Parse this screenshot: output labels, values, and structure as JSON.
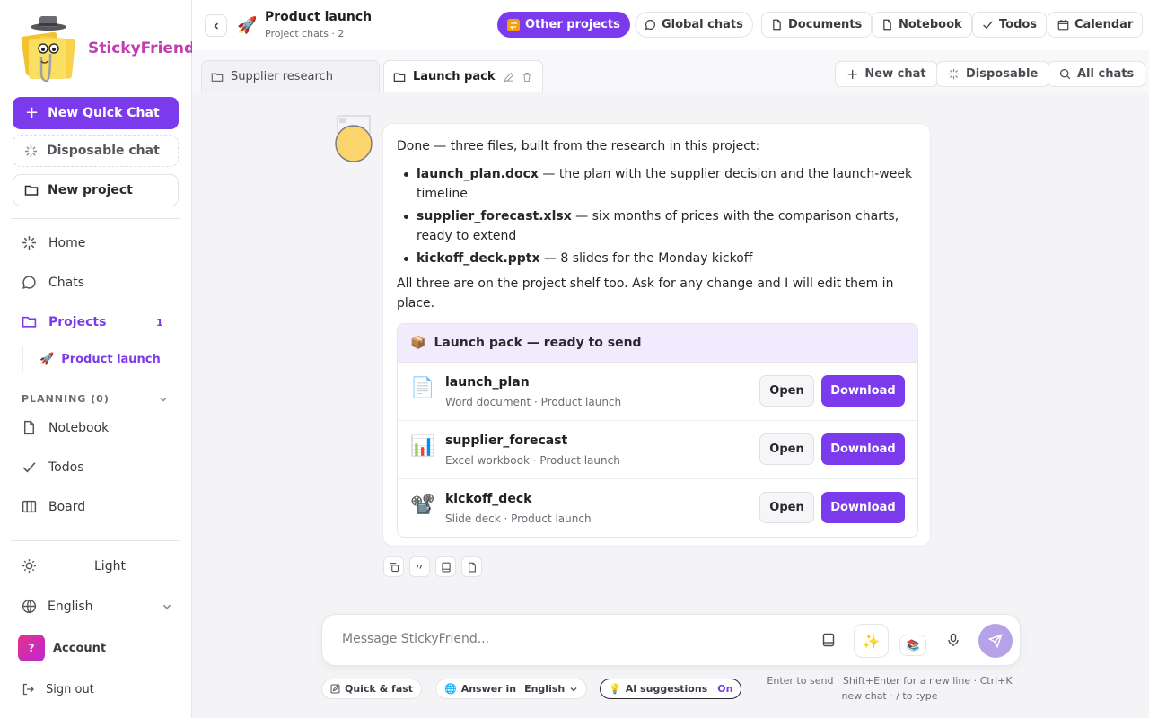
{
  "brand": {
    "name": "StickyFriend",
    "color": "#c03fb0"
  },
  "colors": {
    "accent": "#7c3aed",
    "send": "#b6a2e6"
  },
  "sidebar": {
    "new_quick_chat": "New Quick Chat",
    "disposable_chat": "Disposable chat",
    "new_project": "New project",
    "nav": [
      {
        "label": "Home",
        "icon": "sparkle-icon"
      },
      {
        "label": "Chats",
        "icon": "chat-bubble-icon"
      },
      {
        "label": "Projects",
        "icon": "folder-icon",
        "count": "1"
      }
    ],
    "project_child": {
      "emoji": "🚀",
      "label": "Product launch"
    },
    "planning": {
      "title": "PLANNING (0)",
      "items": [
        {
          "label": "Notebook",
          "icon": "document-icon"
        },
        {
          "label": "Todos",
          "icon": "check-icon"
        },
        {
          "label": "Board",
          "icon": "board-icon"
        }
      ]
    },
    "theme_label": "Light",
    "language_label": "English",
    "account": {
      "initial": "?",
      "label": "Account"
    },
    "sign_out": "Sign out"
  },
  "topbar": {
    "project_emoji": "🚀",
    "project_title": "Product launch",
    "project_subtitle": "Project chats · 2",
    "other_projects": "Other projects",
    "global_chats": "Global chats",
    "documents": "Documents",
    "notebook": "Notebook",
    "todos": "Todos",
    "calendar": "Calendar"
  },
  "tabs": [
    {
      "label": "Supplier research",
      "active": false
    },
    {
      "label": "Launch pack",
      "active": true
    }
  ],
  "tab_actions": {
    "new_chat": "New chat",
    "disposable": "Disposable",
    "all_chats": "All chats"
  },
  "message": {
    "intro": "Done — three files, built from the research in this project:",
    "bullets": [
      {
        "name": "launch_plan.docx",
        "text": " — the plan with the supplier decision and the launch-week timeline"
      },
      {
        "name": "supplier_forecast.xlsx",
        "text": " — six months of prices with the comparison charts, ready to extend"
      },
      {
        "name": "kickoff_deck.pptx",
        "text": " — 8 slides for the Monday kickoff"
      }
    ],
    "outro": "All three are on the project shelf too. Ask for any change and I will edit them in place.",
    "pack_emoji": "📦",
    "pack_title": "Launch pack — ready to send",
    "files": [
      {
        "icon": "📄",
        "name": "launch_plan",
        "meta": "Word document · Product launch"
      },
      {
        "icon": "📊",
        "name": "supplier_forecast",
        "meta": "Excel workbook · Product launch"
      },
      {
        "icon": "📽️",
        "name": "kickoff_deck",
        "meta": "Slide deck · Product launch"
      }
    ],
    "open_label": "Open",
    "download_label": "Download"
  },
  "composer": {
    "placeholder": "Message StickyFriend...",
    "sparkle": "✨",
    "books": "📚"
  },
  "chips": {
    "quick": "Quick & fast",
    "answer_in": "Answer in",
    "language": "English",
    "ai_emoji": "💡",
    "ai_suggestions": "AI suggestions",
    "ai_state": "On"
  },
  "hint": "Enter to send · Shift+Enter for a new line · Ctrl+K new chat · / to type"
}
